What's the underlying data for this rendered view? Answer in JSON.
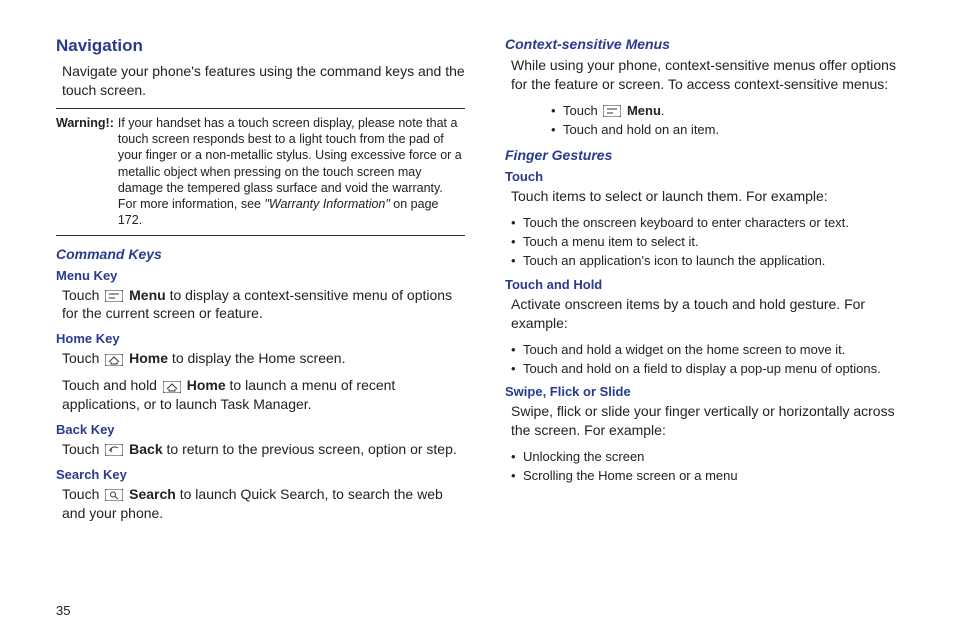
{
  "page_number": "35",
  "left": {
    "title": "Navigation",
    "intro": "Navigate your phone's features using the command keys and the touch screen.",
    "warning_label": "Warning!:",
    "warning_text_a": "If your handset has a touch screen display, please note that a touch screen responds best to a light touch from the pad of your finger or a non-metallic stylus. Using excessive force or a metallic object when pressing on the touch screen may damage the tempered glass surface and void the warranty. For more information, see ",
    "warning_ref": "\"Warranty Information\"",
    "warning_text_b": " on page 172.",
    "command_keys_heading": "Command Keys",
    "menu_key_heading": "Menu Key",
    "menu_key_p_a": "Touch ",
    "menu_key_bold": "Menu",
    "menu_key_p_b": " to display a context-sensitive menu of options for the current screen or feature.",
    "home_key_heading": "Home Key",
    "home_key_p1_a": "Touch ",
    "home_key_p1_bold": "Home",
    "home_key_p1_b": " to display the Home screen.",
    "home_key_p2_a": "Touch and hold ",
    "home_key_p2_bold": "Home",
    "home_key_p2_b": " to launch a menu of recent applications, or to launch Task Manager.",
    "back_key_heading": "Back Key",
    "back_key_p_a": "Touch ",
    "back_key_bold": "Back",
    "back_key_p_b": " to return to the previous screen, option or step.",
    "search_key_heading": "Search Key",
    "search_key_p_a": "Touch ",
    "search_key_bold": "Search",
    "search_key_p_b": " to launch Quick Search, to search the web and your phone."
  },
  "right": {
    "ctx_heading": "Context-sensitive Menus",
    "ctx_intro": "While using your phone, context-sensitive menus offer options for the feature or screen. To access context-sensitive menus:",
    "ctx_b1_a": "Touch ",
    "ctx_b1_bold": "Menu",
    "ctx_b1_b": ".",
    "ctx_b2": "Touch and hold on an item.",
    "finger_heading": "Finger Gestures",
    "touch_heading": "Touch",
    "touch_intro": "Touch items to select or launch them. For example:",
    "touch_b1": "Touch the onscreen keyboard to enter characters or text.",
    "touch_b2": "Touch a menu item to select it.",
    "touch_b3": "Touch an application's icon to launch the application.",
    "hold_heading": "Touch and Hold",
    "hold_intro": "Activate onscreen items by a touch and hold gesture. For example:",
    "hold_b1": "Touch and hold a widget on the home screen to move it.",
    "hold_b2": "Touch and hold on a field to display a pop-up menu of options.",
    "swipe_heading": "Swipe, Flick or Slide",
    "swipe_intro": "Swipe, flick or slide your finger vertically or horizontally across the screen. For example:",
    "swipe_b1": "Unlocking the screen",
    "swipe_b2": "Scrolling the Home screen or a menu"
  }
}
